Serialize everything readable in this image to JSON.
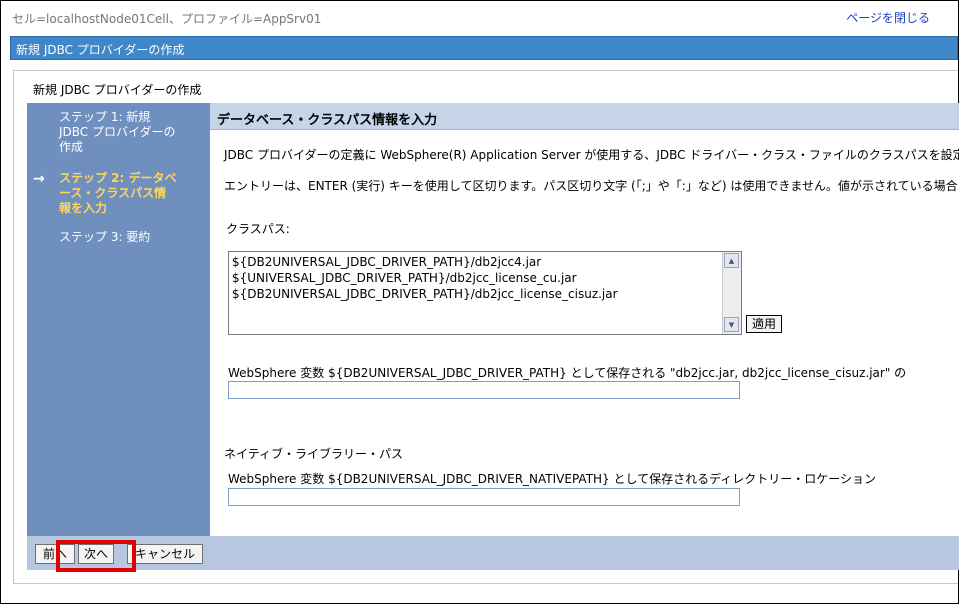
{
  "header": {
    "cell_info": "セル=localhostNode01Cell、プロファイル=AppSrv01",
    "close_link": "ページを閉じる"
  },
  "title_bar": "新規 JDBC プロバイダーの作成",
  "wizard": {
    "heading": "新規 JDBC プロバイダーの作成",
    "steps": [
      {
        "label_lines": [
          "ステップ 1: 新規",
          "JDBC プロバイダーの",
          "作成"
        ]
      },
      {
        "label_lines": [
          "ステップ 2: データベ",
          "ース・クラスパス情",
          "報を入力"
        ],
        "current": true
      },
      {
        "label_lines": [
          "ステップ 3: 要約"
        ]
      }
    ],
    "current_arrow": "→"
  },
  "content": {
    "section_title": "データベース・クラスパス情報を入力",
    "description1": "JDBC プロバイダーの定義に WebSphere(R) Application Server が使用する、JDBC ドライバー・クラス・ファイルのクラスパスを設定",
    "description2": "エントリーは、ENTER (実行) キーを使用して区切ります。パス区切り文字 (「;」や「:」など) は使用できません。値が示されている場合",
    "classpath_label": "クラスパス:",
    "classpath_lines": [
      "${DB2UNIVERSAL_JDBC_DRIVER_PATH}/db2jcc4.jar",
      "${UNIVERSAL_JDBC_DRIVER_PATH}/db2jcc_license_cu.jar",
      "${DB2UNIVERSAL_JDBC_DRIVER_PATH}/db2jcc_license_cisuz.jar"
    ],
    "apply_button": "適用",
    "driver_path_label": "WebSphere 変数 ${DB2UNIVERSAL_JDBC_DRIVER_PATH} として保存される \"db2jcc.jar, db2jcc_license_cisuz.jar\" の",
    "driver_path_value": "",
    "native_section": "ネイティブ・ライブラリー・パス",
    "native_path_label": "WebSphere 変数 ${DB2UNIVERSAL_JDBC_DRIVER_NATIVEPATH} として保存されるディレクトリー・ロケーション",
    "native_path_value": ""
  },
  "footer": {
    "prev_button": "前へ",
    "next_button": "次へ",
    "cancel_button": "キャンセル"
  },
  "colors": {
    "title_bar": "#3f87c9",
    "steps_panel": "#6f8fbf",
    "current_step": "#ffd65c",
    "highlight": "#e00000"
  }
}
